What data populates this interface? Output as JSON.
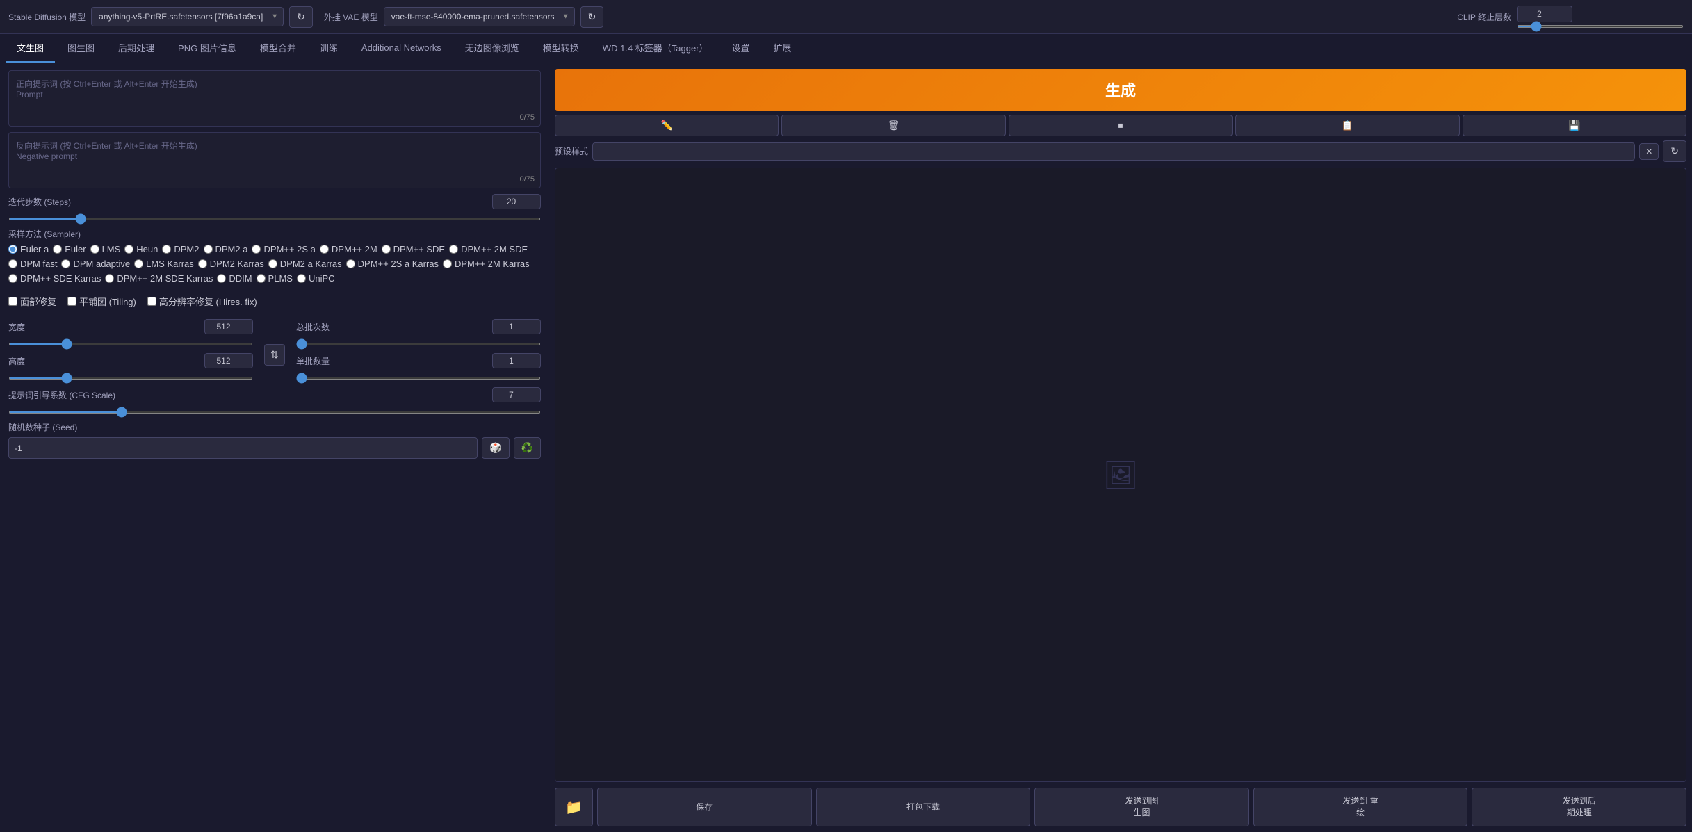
{
  "topBar": {
    "sdModelLabel": "Stable Diffusion 模型",
    "sdModelValue": "anything-v5-PrtRE.safetensors [7f96a1a9ca]",
    "vaeModelLabel": "外挂 VAE 模型",
    "vaeModelValue": "vae-ft-mse-840000-ema-pruned.safetensors",
    "clipLabel": "CLIP 终止层数",
    "clipValue": "2",
    "refreshIcon": "↻"
  },
  "tabs": [
    {
      "id": "txt2img",
      "label": "文生图",
      "active": true
    },
    {
      "id": "img2img",
      "label": "图生图",
      "active": false
    },
    {
      "id": "postprocessing",
      "label": "后期处理",
      "active": false
    },
    {
      "id": "pnginfo",
      "label": "PNG 图片信息",
      "active": false
    },
    {
      "id": "modelmerge",
      "label": "模型合并",
      "active": false
    },
    {
      "id": "train",
      "label": "训练",
      "active": false
    },
    {
      "id": "additionalnetworks",
      "label": "Additional Networks",
      "active": false
    },
    {
      "id": "infiniteimagegrid",
      "label": "无边图像浏览",
      "active": false
    },
    {
      "id": "modelconverter",
      "label": "模型转换",
      "active": false
    },
    {
      "id": "tagger",
      "label": "WD 1.4 标签器（Tagger）",
      "active": false
    },
    {
      "id": "settings",
      "label": "设置",
      "active": false
    },
    {
      "id": "extensions",
      "label": "扩展",
      "active": false
    }
  ],
  "prompts": {
    "positive": {
      "placeholder": "正向提示词 (按 Ctrl+Enter 或 Alt+Enter 开始生成)\nPrompt",
      "counter": "0/75"
    },
    "negative": {
      "placeholder": "反向提示词 (按 Ctrl+Enter 或 Alt+Enter 开始生成)\nNegative prompt",
      "counter": "0/75"
    }
  },
  "generateBtn": "生成",
  "toolBtns": [
    {
      "id": "pencil",
      "icon": "✏️"
    },
    {
      "id": "trash",
      "icon": "🗑"
    },
    {
      "id": "stop",
      "icon": "⏹"
    },
    {
      "id": "copy",
      "icon": "📋"
    },
    {
      "id": "save",
      "icon": "💾"
    }
  ],
  "stylePreset": {
    "label": "预设样式",
    "placeholder": "",
    "xBtn": "✕"
  },
  "steps": {
    "label": "迭代步数 (Steps)",
    "value": "20",
    "min": 1,
    "max": 150
  },
  "sampler": {
    "label": "采样方法 (Sampler)",
    "options": [
      "Euler a",
      "Euler",
      "LMS",
      "Heun",
      "DPM2",
      "DPM2 a",
      "DPM++ 2S a",
      "DPM++ 2M",
      "DPM++ SDE",
      "DPM++ 2M SDE",
      "DPM fast",
      "DPM adaptive",
      "LMS Karras",
      "DPM2 Karras",
      "DPM2 a Karras",
      "DPM++ 2S a Karras",
      "DPM++ 2M Karras",
      "DPM++ SDE Karras",
      "DPM++ 2M SDE Karras",
      "DDIM",
      "PLMS",
      "UniPC"
    ],
    "selected": "Euler a"
  },
  "checkboxes": [
    {
      "id": "face-restore",
      "label": "面部修复",
      "checked": false
    },
    {
      "id": "tiling",
      "label": "平铺图 (Tiling)",
      "checked": false
    },
    {
      "id": "hires-fix",
      "label": "高分辨率修复 (Hires. fix)",
      "checked": false
    }
  ],
  "width": {
    "label": "宽度",
    "value": "512",
    "min": 64,
    "max": 2048
  },
  "height": {
    "label": "高度",
    "value": "512",
    "min": 64,
    "max": 2048
  },
  "swapBtn": "⇅",
  "totalBatches": {
    "label": "总批次数",
    "value": "1",
    "min": 1,
    "max": 100
  },
  "batchSize": {
    "label": "单批数量",
    "value": "1",
    "min": 1,
    "max": 8
  },
  "cfgScale": {
    "label": "提示词引导系数 (CFG Scale)",
    "value": "7",
    "min": 1,
    "max": 30
  },
  "seed": {
    "label": "随机数种子 (Seed)"
  },
  "actionBtns": [
    {
      "id": "folder",
      "icon": "📁",
      "type": "folder"
    },
    {
      "id": "save",
      "label": "保存"
    },
    {
      "id": "zip-download",
      "label": "打包下载"
    },
    {
      "id": "send-txt2img",
      "label": "发送到图\n生图"
    },
    {
      "id": "send-inpaint",
      "label": "发送到 重\n绘"
    },
    {
      "id": "send-postprocess",
      "label": "发送到后\n期处理"
    }
  ],
  "imagePreviewIcon": "🖼"
}
